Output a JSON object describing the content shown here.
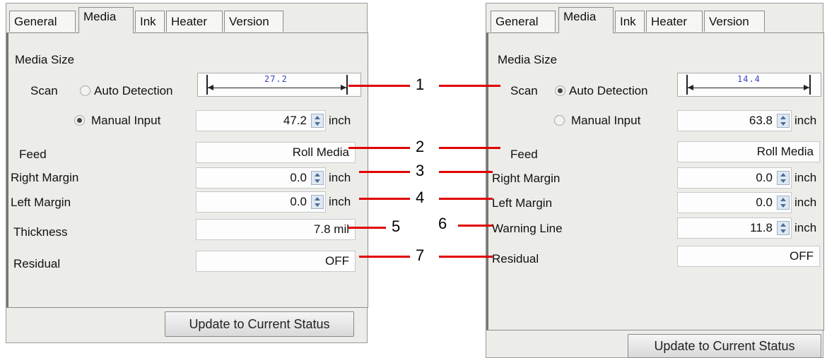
{
  "tabs": [
    "General",
    "Media",
    "Ink",
    "Heater",
    "Version"
  ],
  "left": {
    "media_size_label": "Media Size",
    "scan_label": "Scan",
    "auto_detection_label": "Auto Detection",
    "ruler_value": "27.2",
    "manual_input_label": "Manual Input",
    "manual_input_value": "47.2",
    "unit": "inch",
    "feed_label": "Feed",
    "feed_value": "Roll Media",
    "right_margin_label": "Right Margin",
    "right_margin_value": "0.0",
    "left_margin_label": "Left Margin",
    "left_margin_value": "0.0",
    "thickness_label": "Thickness",
    "thickness_value": "7.8 mil",
    "residual_label": "Residual",
    "residual_value": "OFF",
    "update_button": "Update to Current Status"
  },
  "right": {
    "media_size_label": "Media Size",
    "scan_label": "Scan",
    "auto_detection_label": "Auto Detection",
    "ruler_value": "14.4",
    "manual_input_label": "Manual Input",
    "manual_input_value": "63.8",
    "unit": "inch",
    "feed_label": "Feed",
    "feed_value": "Roll Media",
    "right_margin_label": "Right Margin",
    "right_margin_value": "0.0",
    "left_margin_label": "Left Margin",
    "left_margin_value": "0.0",
    "warning_line_label": "Warning Line",
    "warning_line_value": "11.8",
    "residual_label": "Residual",
    "residual_value": "OFF",
    "update_button": "Update to Current Status"
  },
  "callouts": [
    "1",
    "2",
    "3",
    "4",
    "5",
    "6",
    "7"
  ],
  "colors": {
    "callout_line": "#e00000",
    "ruler_text": "#3a44c6",
    "panel_bg": "#ecece9"
  }
}
